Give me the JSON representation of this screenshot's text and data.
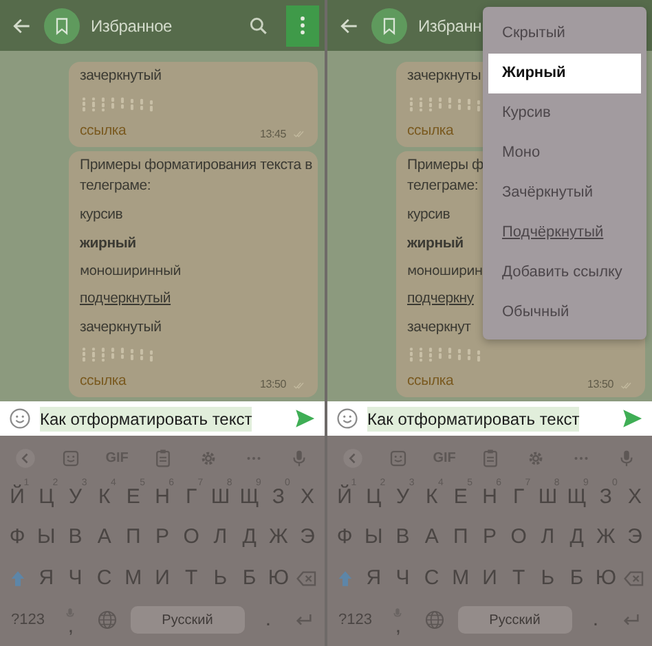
{
  "panels": [
    {
      "header": {
        "title": "Избранное",
        "actions": [
          {
            "kind": "search",
            "highlighted": false
          },
          {
            "kind": "more",
            "highlighted": true
          }
        ]
      },
      "messages": [
        {
          "lines": [
            {
              "kind": "plain",
              "text": "зачеркнутый"
            },
            {
              "kind": "spoiler"
            },
            {
              "kind": "link",
              "text": "ссылка"
            }
          ],
          "time": "13:45"
        },
        {
          "lines": [
            {
              "kind": "plain",
              "text": "Примеры форматирования текста в"
            },
            {
              "kind": "cont",
              "text": "телеграме:"
            },
            {
              "kind": "plain",
              "text": "курсив"
            },
            {
              "kind": "bold",
              "text": "жирный"
            },
            {
              "kind": "mono",
              "text": "моноширинный"
            },
            {
              "kind": "underline",
              "text": "подчеркнутый"
            },
            {
              "kind": "plain",
              "text": "зачеркнутый"
            },
            {
              "kind": "spoiler"
            },
            {
              "kind": "link",
              "text": "ссылка"
            }
          ],
          "time": "13:50"
        }
      ],
      "input": {
        "value": "Как отформатировать текст"
      },
      "keyboard": {
        "toolbar": [
          {
            "kind": "back"
          },
          {
            "kind": "sticker"
          },
          {
            "kind": "text",
            "text": "GIF"
          },
          {
            "kind": "clipboard"
          },
          {
            "kind": "settings"
          },
          {
            "kind": "more"
          },
          {
            "kind": "mic"
          }
        ],
        "row_1": [
          {
            "key": "Й",
            "hint": "1"
          },
          {
            "key": "Ц",
            "hint": "2"
          },
          {
            "key": "У",
            "hint": "3"
          },
          {
            "key": "К",
            "hint": "4"
          },
          {
            "key": "Е",
            "hint": "5"
          },
          {
            "key": "Н",
            "hint": "6"
          },
          {
            "key": "Г",
            "hint": "7"
          },
          {
            "key": "Ш",
            "hint": "8"
          },
          {
            "key": "Щ",
            "hint": "9"
          },
          {
            "key": "З",
            "hint": "0"
          },
          {
            "key": "Х"
          }
        ],
        "row_2": [
          {
            "key": "Ф"
          },
          {
            "key": "Ы"
          },
          {
            "key": "В"
          },
          {
            "key": "А"
          },
          {
            "key": "П"
          },
          {
            "key": "Р"
          },
          {
            "key": "О"
          },
          {
            "key": "Л"
          },
          {
            "key": "Д"
          },
          {
            "key": "Ж"
          },
          {
            "key": "Э"
          }
        ],
        "row_3": [
          {
            "kind": "shift"
          },
          {
            "key": "Я"
          },
          {
            "key": "Ч"
          },
          {
            "key": "С"
          },
          {
            "key": "М"
          },
          {
            "key": "И"
          },
          {
            "key": "Т"
          },
          {
            "key": "Ь"
          },
          {
            "key": "Б"
          },
          {
            "key": "Ю"
          },
          {
            "kind": "backspace"
          }
        ],
        "bottom_row": [
          {
            "key": "?123",
            "kind": "wide"
          },
          {
            "kind": "comma",
            "key": ","
          },
          {
            "kind": "globe"
          },
          {
            "kind": "space",
            "key": "Русский"
          },
          {
            "key": "."
          },
          {
            "kind": "enter"
          }
        ]
      }
    },
    {
      "header": {
        "title": "Избранн"
      },
      "messages": [
        {
          "lines": [
            {
              "kind": "plain",
              "text": "зачеркнуты"
            },
            {
              "kind": "spoiler"
            },
            {
              "kind": "link",
              "text": "ссылка"
            }
          ]
        },
        {
          "lines": [
            {
              "kind": "plain",
              "text": "Примеры ф"
            },
            {
              "kind": "cont",
              "text": "телеграме:"
            },
            {
              "kind": "plain",
              "text": "курсив"
            },
            {
              "kind": "bold",
              "text": "жирный"
            },
            {
              "kind": "mono",
              "text": "моноширин"
            },
            {
              "kind": "underline",
              "text": "подчеркну"
            },
            {
              "kind": "plain",
              "text": "зачеркнут"
            },
            {
              "kind": "spoiler"
            },
            {
              "kind": "link",
              "text": "ссылка"
            }
          ],
          "time": "13:50"
        }
      ],
      "menu": {
        "items": [
          {
            "label": "Скрытый",
            "kind": "plain",
            "selected": false
          },
          {
            "label": "Жирный",
            "kind": "plain",
            "selected": true
          },
          {
            "label": "Курсив",
            "kind": "plain",
            "selected": false
          },
          {
            "label": "Моно",
            "kind": "plain",
            "selected": false
          },
          {
            "label": "Зачёркнутый",
            "kind": "plain",
            "selected": false
          },
          {
            "label": "Подчёркнутый",
            "kind": "underline",
            "selected": false
          },
          {
            "label": "Добавить ссылку",
            "kind": "plain",
            "selected": false
          },
          {
            "label": "Обычный",
            "kind": "plain",
            "selected": false
          }
        ]
      },
      "input": {
        "value": "Как отформатировать текст"
      },
      "keyboard": {
        "toolbar": [
          {
            "kind": "back"
          },
          {
            "kind": "sticker"
          },
          {
            "kind": "text",
            "text": "GIF"
          },
          {
            "kind": "clipboard"
          },
          {
            "kind": "settings"
          },
          {
            "kind": "more"
          },
          {
            "kind": "mic"
          }
        ],
        "row_1": [
          {
            "key": "Й",
            "hint": "1"
          },
          {
            "key": "Ц",
            "hint": "2"
          },
          {
            "key": "У",
            "hint": "3"
          },
          {
            "key": "К",
            "hint": "4"
          },
          {
            "key": "Е",
            "hint": "5"
          },
          {
            "key": "Н",
            "hint": "6"
          },
          {
            "key": "Г",
            "hint": "7"
          },
          {
            "key": "Ш",
            "hint": "8"
          },
          {
            "key": "Щ",
            "hint": "9"
          },
          {
            "key": "З",
            "hint": "0"
          },
          {
            "key": "Х"
          }
        ],
        "row_2": [
          {
            "key": "Ф"
          },
          {
            "key": "Ы"
          },
          {
            "key": "В"
          },
          {
            "key": "А"
          },
          {
            "key": "П"
          },
          {
            "key": "Р"
          },
          {
            "key": "О"
          },
          {
            "key": "Л"
          },
          {
            "key": "Д"
          },
          {
            "key": "Ж"
          },
          {
            "key": "Э"
          }
        ],
        "row_3": [
          {
            "kind": "shift"
          },
          {
            "key": "Я"
          },
          {
            "key": "Ч"
          },
          {
            "key": "С"
          },
          {
            "key": "М"
          },
          {
            "key": "И"
          },
          {
            "key": "Т"
          },
          {
            "key": "Ь"
          },
          {
            "key": "Б"
          },
          {
            "key": "Ю"
          },
          {
            "kind": "backspace"
          }
        ],
        "bottom_row": [
          {
            "key": "?123",
            "kind": "wide"
          },
          {
            "kind": "comma",
            "key": ","
          },
          {
            "kind": "globe"
          },
          {
            "kind": "space",
            "key": "Русский"
          },
          {
            "key": "."
          },
          {
            "kind": "enter"
          }
        ]
      }
    }
  ]
}
